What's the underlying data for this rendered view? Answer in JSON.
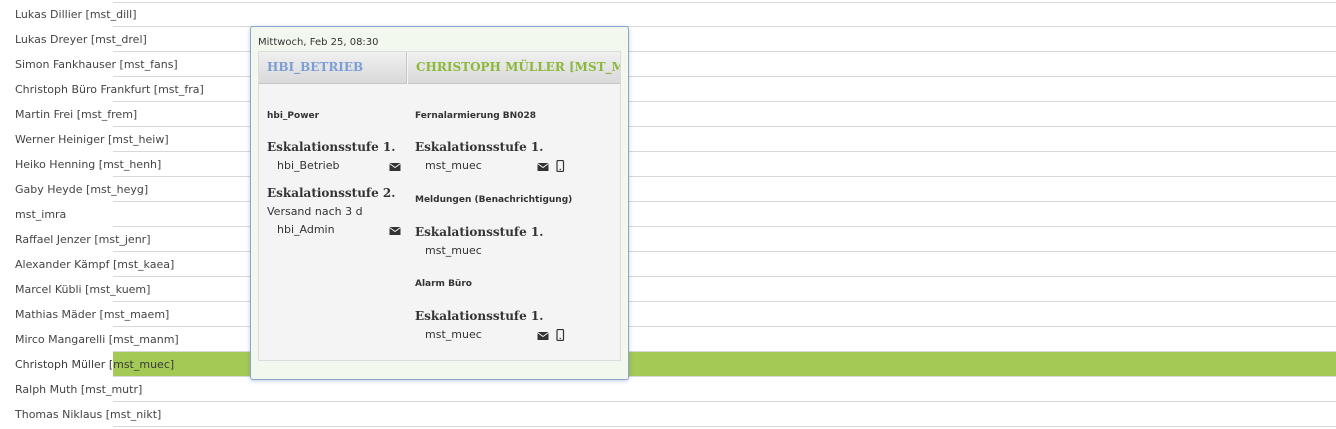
{
  "users": [
    {
      "label": "Lukas Dillier [mst_dill]"
    },
    {
      "label": "Lukas Dreyer [mst_drel]"
    },
    {
      "label": "Simon Fankhauser [mst_fans]"
    },
    {
      "label": "Christoph Büro Frankfurt [mst_fra]"
    },
    {
      "label": "Martin Frei [mst_frem]"
    },
    {
      "label": "Werner Heiniger [mst_heiw]"
    },
    {
      "label": "Heiko Henning [mst_henh]"
    },
    {
      "label": "Gaby Heyde [mst_heyg]"
    },
    {
      "label": "mst_imra"
    },
    {
      "label": "Raffael Jenzer [mst_jenr]"
    },
    {
      "label": "Alexander Kämpf [mst_kaea]"
    },
    {
      "label": "Marcel Kübli [mst_kuem]"
    },
    {
      "label": "Mathias Mäder [mst_maem]"
    },
    {
      "label": "Mirco Mangarelli [mst_manm]"
    },
    {
      "label": "Christoph Müller [mst_muec]"
    },
    {
      "label": "Ralph Muth [mst_mutr]"
    },
    {
      "label": "Thomas Niklaus [mst_nikt]"
    }
  ],
  "highlight_color": "#a5c955",
  "popup": {
    "date": "Mittwoch, Feb 25, 08:30",
    "left_header": "HBI_BETRIEB",
    "right_header": "CHRISTOPH MÜLLER [MST_MUEC]",
    "left_header_color": "#7a9fd6",
    "right_header_color": "#8bb83a",
    "left": {
      "group": "hbi_Power",
      "stufe1": "Eskalationsstufe 1.",
      "stufe1_recipient": "hbi_Betrieb",
      "stufe2": "Eskalationsstufe 2.",
      "stufe2_note": "Versand nach 3 d",
      "stufe2_recipient": "hbi_Admin"
    },
    "right": {
      "group1": "Fernalarmierung BN028",
      "group1_stufe": "Eskalationsstufe 1.",
      "group1_recipient": "mst_muec",
      "group2": "Meldungen (Benachrichtigung)",
      "group2_stufe": "Eskalationsstufe 1.",
      "group2_recipient": "mst_muec",
      "group3": "Alarm Büro",
      "group3_stufe": "Eskalationsstufe 1.",
      "group3_recipient": "mst_muec"
    },
    "icons": [
      "envelope-icon",
      "mobile-phone-icon"
    ]
  }
}
